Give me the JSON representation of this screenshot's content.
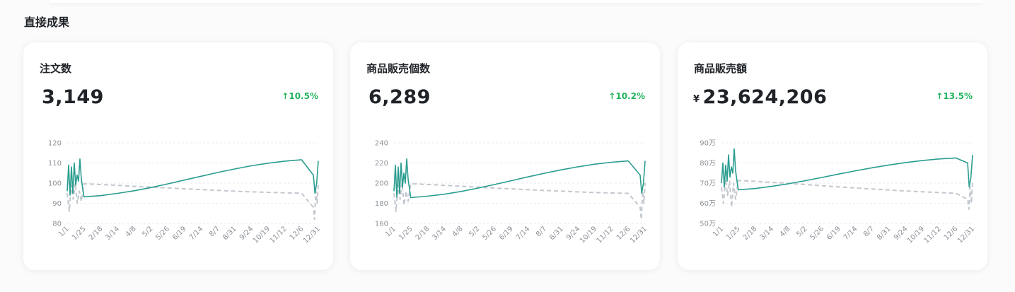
{
  "section": {
    "title": "直接成果"
  },
  "cards": [
    {
      "title": "注文数",
      "prefix": "",
      "value": "3,149",
      "change_arrow": "↑",
      "change": "10.5%"
    },
    {
      "title": "商品販売個数",
      "prefix": "",
      "value": "6,289",
      "change_arrow": "↑",
      "change": "10.2%"
    },
    {
      "title": "商品販売額",
      "prefix": "¥",
      "value": "23,624,206",
      "change_arrow": "↑",
      "change": "13.5%"
    }
  ],
  "colors": {
    "current": "#2a9d8f",
    "previous": "#c3c8cf",
    "positive": "#22b35e",
    "grid": "#e8eaed"
  },
  "chart_data": [
    {
      "type": "line",
      "x": [
        "1/1",
        "1/25",
        "2/18",
        "3/14",
        "4/8",
        "5/2",
        "5/26",
        "6/19",
        "7/14",
        "8/7",
        "8/31",
        "9/24",
        "10/19",
        "11/12",
        "12/6",
        "12/31"
      ],
      "yticks": [
        "80",
        "90",
        "100",
        "110",
        "120"
      ],
      "ylim": [
        80,
        120
      ],
      "grid": true,
      "series": [
        {
          "style": "solid",
          "trend": [
            93,
            93.2,
            93.8,
            94.9,
            96.2,
            97.8,
            99.6,
            101.5,
            103.4,
            105.3,
            107,
            108.6,
            109.9,
            110.9,
            111.6,
            111.9
          ],
          "start_spikes": [
            96,
            109,
            94,
            108,
            95,
            110,
            99,
            104,
            101,
            112,
            102
          ],
          "end_spikes": [
            104,
            95,
            100,
            111
          ]
        },
        {
          "style": "dashed",
          "trend": [
            100,
            99.7,
            99.3,
            98.9,
            98.4,
            98,
            97.6,
            97.2,
            96.8,
            96.4,
            96,
            95.7,
            95.4,
            95.2,
            95,
            94.9
          ],
          "start_spikes": [
            95,
            86,
            99,
            92,
            100,
            90,
            96,
            91
          ],
          "end_spikes": [
            88,
            82,
            96,
            90,
            100
          ]
        }
      ]
    },
    {
      "type": "line",
      "x": [
        "1/1",
        "1/25",
        "2/18",
        "3/14",
        "4/8",
        "5/2",
        "5/26",
        "6/19",
        "7/14",
        "8/7",
        "8/31",
        "9/24",
        "10/19",
        "11/12",
        "12/6",
        "12/31"
      ],
      "yticks": [
        "160",
        "180",
        "200",
        "220",
        "240"
      ],
      "ylim": [
        160,
        240
      ],
      "grid": true,
      "series": [
        {
          "style": "solid",
          "trend": [
            185,
            185.6,
            187,
            189,
            191.7,
            195,
            198.6,
            202.4,
            206.2,
            209.8,
            213.2,
            216.2,
            218.8,
            220.7,
            222,
            222.6
          ],
          "start_spikes": [
            192,
            218,
            186,
            216,
            190,
            220,
            196,
            210,
            200,
            224,
            204
          ],
          "end_spikes": [
            208,
            190,
            200,
            222
          ]
        },
        {
          "style": "dashed",
          "trend": [
            200,
            199.4,
            198.7,
            197.8,
            196.9,
            196,
            195.1,
            194.3,
            193.5,
            192.7,
            192,
            191.3,
            190.7,
            190.2,
            189.8,
            189.5
          ],
          "start_spikes": [
            190,
            172,
            198,
            184,
            200,
            178,
            192,
            182
          ],
          "end_spikes": [
            176,
            164,
            192,
            180,
            200
          ]
        }
      ]
    },
    {
      "type": "line",
      "x": [
        "1/1",
        "1/25",
        "2/18",
        "3/14",
        "4/8",
        "5/2",
        "5/26",
        "6/19",
        "7/14",
        "8/7",
        "8/31",
        "9/24",
        "10/19",
        "11/12",
        "12/6",
        "12/31"
      ],
      "yticks": [
        "50万",
        "60万",
        "70万",
        "80万",
        "90万"
      ],
      "ylim": [
        50,
        90
      ],
      "grid": true,
      "series": [
        {
          "style": "solid",
          "trend": [
            66.5,
            66.7,
            67.3,
            68.4,
            69.7,
            71.2,
            72.8,
            74.5,
            76.1,
            77.6,
            79,
            80.2,
            81.2,
            82,
            82.5,
            82.8
          ],
          "start_spikes": [
            70,
            80,
            68,
            79,
            71,
            84,
            73,
            78,
            75,
            87,
            76
          ],
          "end_spikes": [
            80,
            68,
            73,
            84
          ]
        },
        {
          "style": "dashed",
          "trend": [
            71.5,
            71.3,
            70.9,
            70.4,
            69.9,
            69.3,
            68.7,
            68.1,
            67.6,
            67.1,
            66.6,
            66.1,
            65.7,
            65.3,
            65,
            64.8
          ],
          "start_spikes": [
            68,
            60,
            72,
            64,
            71,
            58,
            70,
            62
          ],
          "end_spikes": [
            62,
            57,
            68,
            60,
            70
          ]
        }
      ]
    }
  ]
}
